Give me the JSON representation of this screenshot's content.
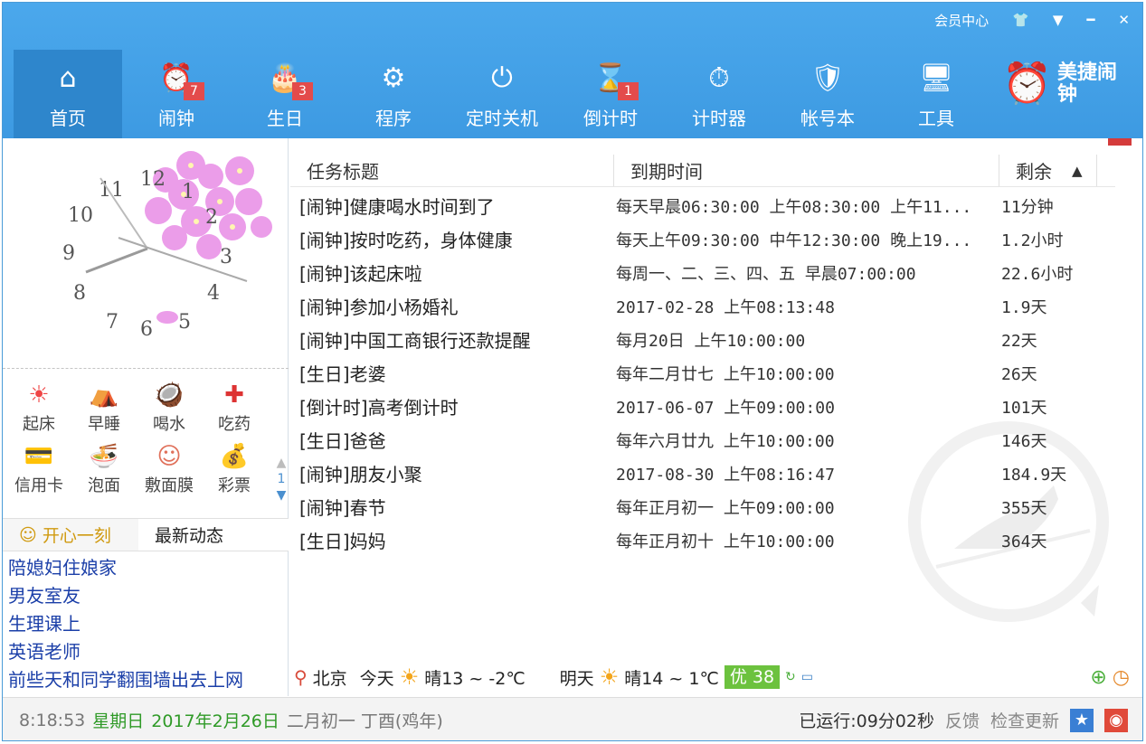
{
  "titlebar": {
    "vip_center": "会员中心",
    "skin_icon": "shirt-icon",
    "menu_icon": "dropdown-icon",
    "minimize_icon": "minimize-icon",
    "close_icon": "close-icon"
  },
  "toolbar": {
    "items": [
      {
        "label": "首页",
        "icon": "home-icon",
        "badge": ""
      },
      {
        "label": "闹钟",
        "icon": "alarm-icon",
        "badge": "7"
      },
      {
        "label": "生日",
        "icon": "cake-icon",
        "badge": "3"
      },
      {
        "label": "程序",
        "icon": "gear-icon",
        "badge": ""
      },
      {
        "label": "定时关机",
        "icon": "power-icon",
        "badge": ""
      },
      {
        "label": "倒计时",
        "icon": "hourglass-icon",
        "badge": "1"
      },
      {
        "label": "计时器",
        "icon": "stopwatch-icon",
        "badge": ""
      },
      {
        "label": "帐号本",
        "icon": "shield-icon",
        "badge": ""
      },
      {
        "label": "工具",
        "icon": "monitor-icon",
        "badge": ""
      }
    ],
    "brand": "美捷闹钟"
  },
  "clock": {
    "numbers": [
      "12",
      "1",
      "2",
      "3",
      "4",
      "5",
      "6",
      "7",
      "8",
      "9",
      "10",
      "11"
    ]
  },
  "shortcuts": [
    {
      "label": "起床",
      "icon": "sun-icon"
    },
    {
      "label": "早睡",
      "icon": "moon-tent-icon"
    },
    {
      "label": "喝水",
      "icon": "coconut-drink-icon"
    },
    {
      "label": "吃药",
      "icon": "medicine-box-icon"
    },
    {
      "label": "信用卡",
      "icon": "credit-card-icon"
    },
    {
      "label": "泡面",
      "icon": "noodle-bowl-icon"
    },
    {
      "label": "敷面膜",
      "icon": "face-mask-icon"
    },
    {
      "label": "彩票",
      "icon": "money-bag-icon"
    }
  ],
  "shortcut_page": "1",
  "left_tabs": {
    "happy": "开心一刻",
    "news": "最新动态"
  },
  "news_items": [
    "陪媳妇住娘家",
    "男友室友",
    "生理课上",
    "英语老师",
    "前些天和同学翻围墙出去上网"
  ],
  "table": {
    "headers": {
      "title": "任务标题",
      "due": "到期时间",
      "remaining": "剩余"
    },
    "rows": [
      {
        "title": "[闹钟]健康喝水时间到了",
        "due": "每天早晨06:30:00 上午08:30:00 上午11...",
        "remaining": "11分钟"
      },
      {
        "title": "[闹钟]按时吃药，身体健康",
        "due": "每天上午09:30:00 中午12:30:00 晚上19...",
        "remaining": "1.2小时"
      },
      {
        "title": "[闹钟]该起床啦",
        "due": "每周一、二、三、四、五 早晨07:00:00",
        "remaining": "22.6小时"
      },
      {
        "title": "[闹钟]参加小杨婚礼",
        "due": "2017-02-28 上午08:13:48",
        "remaining": "1.9天"
      },
      {
        "title": "[闹钟]中国工商银行还款提醒",
        "due": "每月20日 上午10:00:00",
        "remaining": "22天"
      },
      {
        "title": "[生日]老婆",
        "due": "每年二月廿七 上午10:00:00",
        "remaining": "26天"
      },
      {
        "title": "[倒计时]高考倒计时",
        "due": "2017-06-07 上午09:00:00",
        "remaining": "101天"
      },
      {
        "title": "[生日]爸爸",
        "due": "每年六月廿九 上午10:00:00",
        "remaining": "146天"
      },
      {
        "title": "[闹钟]朋友小聚",
        "due": "2017-08-30 上午08:16:47",
        "remaining": "184.9天"
      },
      {
        "title": "[闹钟]春节",
        "due": "每年正月初一 上午09:00:00",
        "remaining": "355天"
      },
      {
        "title": "[生日]妈妈",
        "due": "每年正月初十 上午10:00:00",
        "remaining": "364天"
      }
    ]
  },
  "weather": {
    "city": "北京",
    "today_label": "今天",
    "today": "晴13 ~ -2℃",
    "tomorrow_label": "明天",
    "tomorrow": "晴14 ~ 1℃",
    "aqi": "优 38"
  },
  "status": {
    "time": "8:18:53",
    "weekday": "星期日",
    "date": "2017年2月26日",
    "lunar": "二月初一 丁酉(鸡年)",
    "running": "已运行:09分02秒",
    "feedback": "反馈",
    "update": "检查更新"
  }
}
